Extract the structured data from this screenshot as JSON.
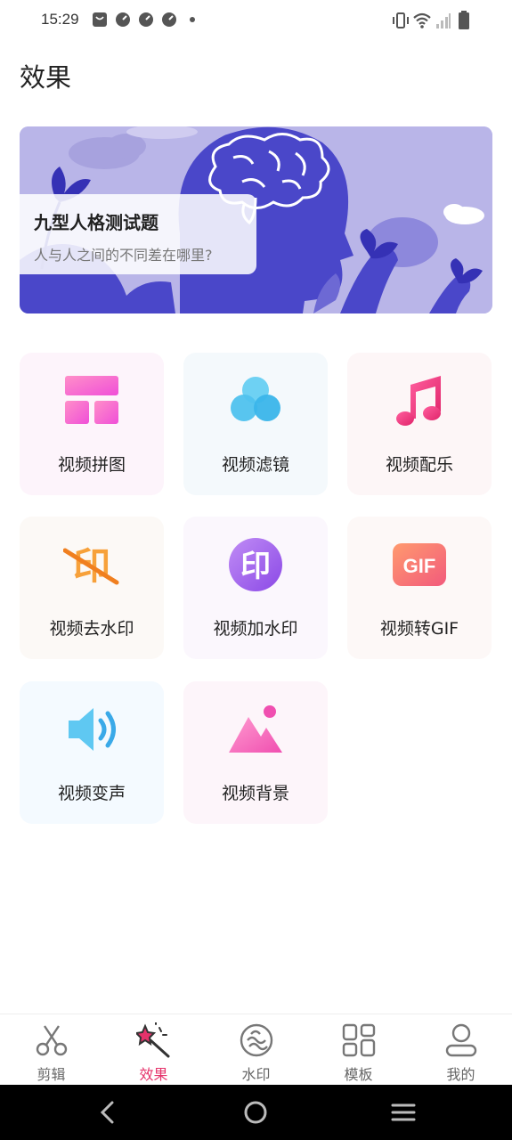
{
  "status_bar": {
    "time": "15:29"
  },
  "page": {
    "title": "效果"
  },
  "banner": {
    "title": "九型人格测试题",
    "subtitle": "人与人之间的不同差在哪里?"
  },
  "tools": [
    {
      "label": "视频拼图",
      "icon": "grid-collage-icon",
      "bg": "#fdf4fb"
    },
    {
      "label": "视频滤镜",
      "icon": "filter-circles-icon",
      "bg": "#f4f9fc"
    },
    {
      "label": "视频配乐",
      "icon": "music-note-icon",
      "bg": "#fdf6f7"
    },
    {
      "label": "视频去水印",
      "icon": "remove-watermark-icon",
      "bg": "#fcf9f6"
    },
    {
      "label": "视频加水印",
      "icon": "add-watermark-icon",
      "bg": "#fbf7fd"
    },
    {
      "label": "视频转GIF",
      "icon": "gif-icon",
      "bg": "#fdf8f7"
    },
    {
      "label": "视频变声",
      "icon": "speaker-icon",
      "bg": "#f4faff"
    },
    {
      "label": "视频背景",
      "icon": "background-image-icon",
      "bg": "#fdf5fa"
    }
  ],
  "bottom_nav": [
    {
      "label": "剪辑",
      "icon": "scissors-icon",
      "active": false
    },
    {
      "label": "效果",
      "icon": "magic-wand-icon",
      "active": true
    },
    {
      "label": "水印",
      "icon": "watermark-icon",
      "active": false
    },
    {
      "label": "模板",
      "icon": "template-grid-icon",
      "active": false
    },
    {
      "label": "我的",
      "icon": "person-icon",
      "active": false
    }
  ],
  "colors": {
    "accent": "#e5336b",
    "banner_bg": "#b7b3e6"
  }
}
